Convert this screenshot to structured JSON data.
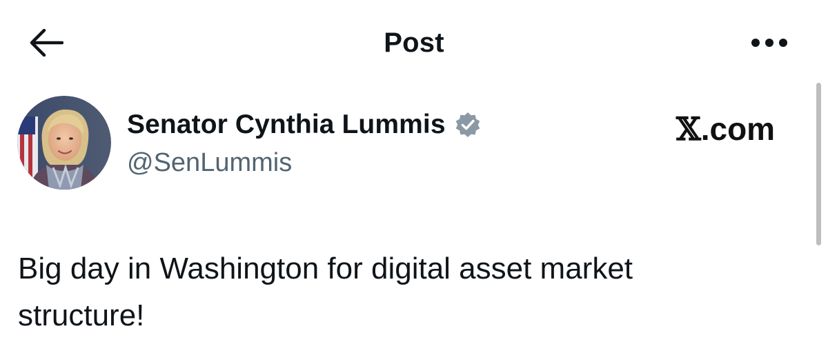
{
  "header": {
    "title": "Post",
    "back_icon": "arrow-left-icon",
    "more_icon": "more-horizontal-icon"
  },
  "author": {
    "name": "Senator Cynthia Lummis",
    "handle": "@SenLummis",
    "verified": true,
    "verified_color": "#8b98a5",
    "avatar_icon": "profile-photo"
  },
  "watermark": {
    "x_mark": "𝕏",
    "suffix": ".com"
  },
  "post": {
    "text": "Big day in Washington for digital asset market\nstructure!"
  },
  "colors": {
    "text_primary": "#0f1419",
    "text_secondary": "#536471",
    "background": "#ffffff"
  }
}
